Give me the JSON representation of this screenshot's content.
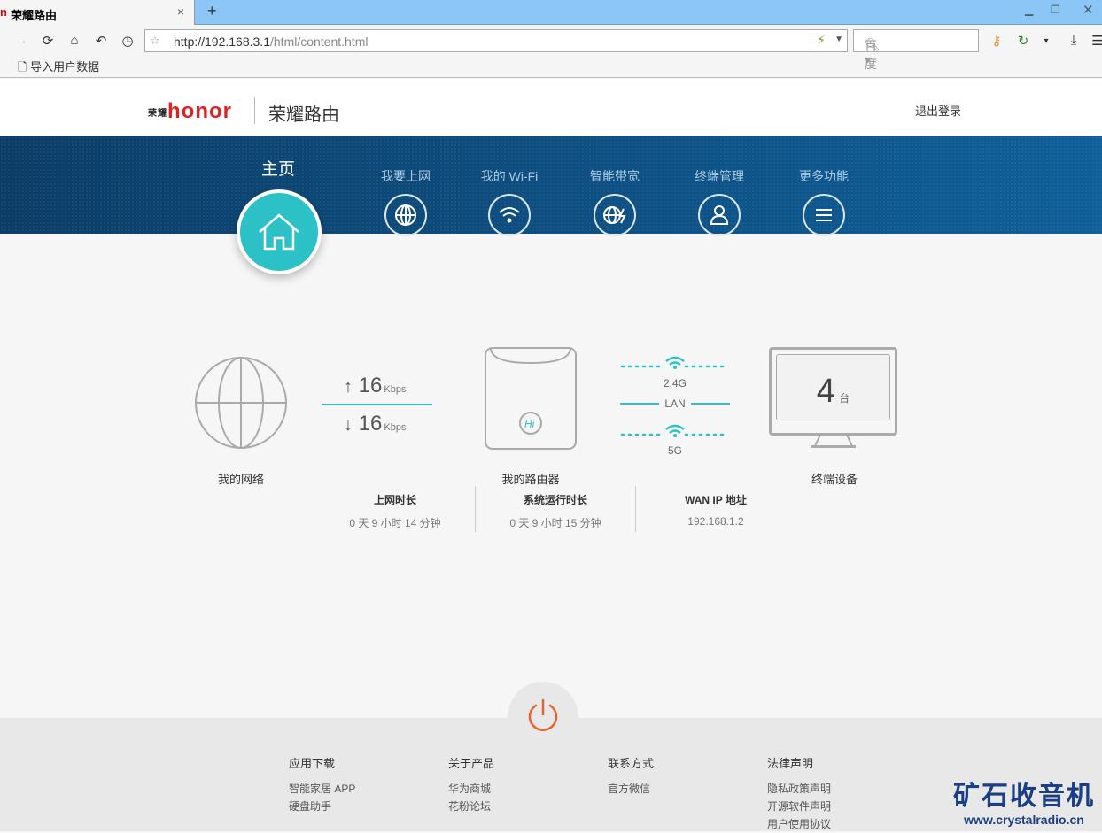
{
  "browser": {
    "tab_title": "荣耀路由",
    "tab_close": "×",
    "new_tab": "+",
    "url_host": "http://192.168.3.1",
    "url_path": "/html/content.html",
    "search_placeholder": "百度",
    "bookmark": "导入用户数据"
  },
  "header": {
    "logo": "honor",
    "logo_prefix": "荣耀",
    "brand": "荣耀路由",
    "logout": "退出登录"
  },
  "nav": {
    "home": "主页",
    "items": [
      {
        "label": "我要上网",
        "icon": "globe-icon"
      },
      {
        "label": "我的 Wi-Fi",
        "icon": "wifi-icon"
      },
      {
        "label": "智能带宽",
        "icon": "bandwidth-icon"
      },
      {
        "label": "终端管理",
        "icon": "user-icon"
      },
      {
        "label": "更多功能",
        "icon": "menu-icon"
      }
    ]
  },
  "status": {
    "network_label": "我的网络",
    "up_speed": "16",
    "down_speed": "16",
    "speed_unit": "Kbps",
    "router_label": "我的路由器",
    "band_24": "2.4G",
    "lan": "LAN",
    "band_5": "5G",
    "device_count": "4",
    "device_unit": "台",
    "devices_label": "终端设备"
  },
  "stats": [
    {
      "title": "上网时长",
      "value": "0 天 9 小时 14 分钟"
    },
    {
      "title": "系统运行时长",
      "value": "0 天 9 小时 15 分钟"
    },
    {
      "title": "WAN IP 地址",
      "value": "192.168.1.2"
    }
  ],
  "footer": {
    "cols": [
      {
        "title": "应用下载",
        "links": [
          "智能家居 APP",
          "硬盘助手"
        ]
      },
      {
        "title": "关于产品",
        "links": [
          "华为商城",
          "花粉论坛"
        ]
      },
      {
        "title": "联系方式",
        "links": [
          "官方微信"
        ]
      },
      {
        "title": "法律声明",
        "links": [
          "隐私政策声明",
          "开源软件声明",
          "用户使用协议"
        ]
      }
    ]
  },
  "watermark": {
    "title": "矿石收音机",
    "url": "www.crystalradio.cn"
  },
  "colors": {
    "accent": "#2bc1c7",
    "nav_bg": "#0f5f99",
    "power": "#e8622a"
  }
}
